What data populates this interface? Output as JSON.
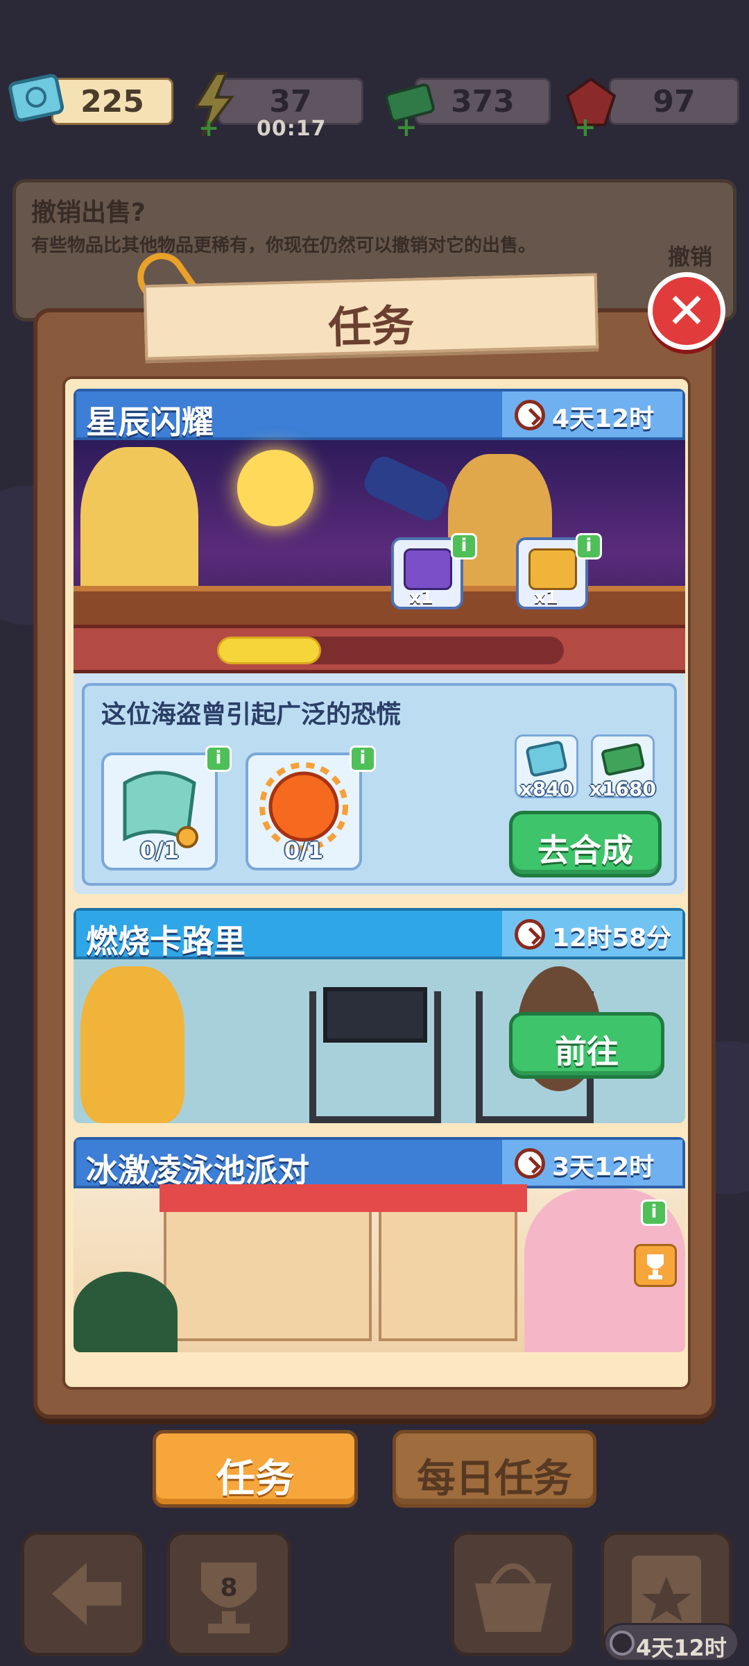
{
  "resources": {
    "tickets": "225",
    "energy": "37",
    "energy_timer": "00:17",
    "cash": "373",
    "gems": "97"
  },
  "bg_dialog": {
    "title": "撤销出售?",
    "desc": "有些物品比其他物品更稀有，你现在仍然可以撤销对它的出售。",
    "undo": "撤销"
  },
  "panel": {
    "title": "任务"
  },
  "quests": [
    {
      "name": "星辰闪耀",
      "time": "4天12时",
      "chest_a": "x1",
      "chest_b": "x1",
      "progress": 0.3,
      "objective": "这位海盗曾引起广泛的恐慌",
      "item1": "0/1",
      "item2": "0/1",
      "reward1": "x840",
      "reward2": "x1680",
      "button": "去合成"
    },
    {
      "name": "燃烧卡路里",
      "time": "12时58分",
      "button": "前往"
    },
    {
      "name": "冰激凌泳池派对",
      "time": "3天12时"
    }
  ],
  "tabs": {
    "quest": "任务",
    "daily": "每日任务"
  },
  "nav": {
    "trophy_level": "8",
    "timer": "4天12时"
  },
  "colors": {
    "accent": "#3ec46a",
    "header": "#3d7ed6",
    "close": "#e23b3b",
    "active_tab": "#f7a63c"
  }
}
